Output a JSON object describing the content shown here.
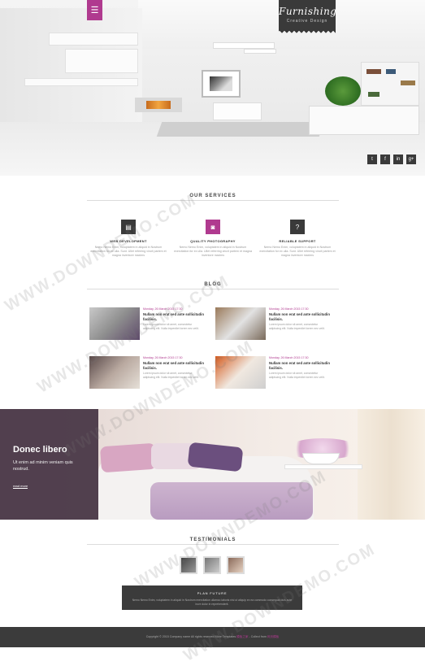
{
  "hero": {
    "menu_icon": "☰",
    "logo_title": "Furnishing",
    "logo_subtitle": "Creative Design",
    "social": [
      "t",
      "f",
      "in",
      "g+"
    ]
  },
  "services": {
    "title": "OUR SERVICES",
    "items": [
      {
        "icon": "document-icon",
        "glyph": "▤",
        "title": "WEB DEVELOPMENT",
        "desc": "Nemo Nemo Enim, voluptatem in aliquid in Nostrum exercitation for ex ulla. Sunt. Ullet referring vincit partem et magna inventore maxims",
        "color": "#3a3a3a"
      },
      {
        "icon": "camera-icon",
        "glyph": "◙",
        "title": "QUALITY PHOTOGRAPHY",
        "desc": "Nemo Nemo Enim, voluptatem in aliquid in Nostrum exercitation for ex ulla. Ullet referring vincit partem et magna inventore maxims",
        "color": "#b03a8f"
      },
      {
        "icon": "question-icon",
        "glyph": "?",
        "title": "RELIABLE SUPPORT",
        "desc": "Nemo Nemo Enim, voluptatem in aliquid in Nostrum exercitation for ex ulla. Sunt. Ullet referring vincit partem et magna inventore maxims",
        "color": "#3a3a3a"
      }
    ]
  },
  "blog": {
    "title": "BLOG",
    "posts": [
      {
        "date": "Monday, 26 March 2015 17:30",
        "title": "Nullam non erat sed ante sollicitudin facilisis.",
        "desc": "Lorem ipsum dolor sit amet, consectetur adipiscing elit. Nulla imperdiet lorem nec velit."
      },
      {
        "date": "Monday, 26 March 2015 17:30",
        "title": "Nullam non erat sed ante sollicitudin facilisis.",
        "desc": "Lorem ipsum dolor sit amet, consectetur adipiscing elit. Nulla imperdiet lorem nec velit."
      },
      {
        "date": "Monday, 26 March 2015 17:30",
        "title": "Nullam non erat sed ante sollicitudin facilisis.",
        "desc": "Lorem ipsum dolor sit amet, consectetur adipiscing elit. Nulla imperdiet lorem nec velit."
      },
      {
        "date": "Monday, 26 March 2015 17:30",
        "title": "Nullam non erat sed ante sollicitudin facilisis.",
        "desc": "Lorem ipsum dolor sit amet, consectetur adipiscing elit. Nulla imperdiet lorem nec velit."
      }
    ]
  },
  "banner": {
    "title": "Donec libero",
    "subtitle": "Ut enim ad minim veniam quis nostrud.",
    "link": "read more"
  },
  "testimonials": {
    "title": "TESTIMONIALS",
    "quote_title": "PLAN FUTURE",
    "quote_text": "Nemo Nemo Enim, voluptatem in aliquid in Nostrum exercitation ullamco laboris nisi ut aliquip ex ea commodo consequat duis aute irure dolor in reprehenderit."
  },
  "footer": {
    "text_before": "Copyright © 2015 Company name All rights reserved More Templates",
    "link1": "模板之家",
    "text_mid": " - Collect from ",
    "link2": "网页模板"
  },
  "watermark": "WWW.DOWNDEMO.COM"
}
